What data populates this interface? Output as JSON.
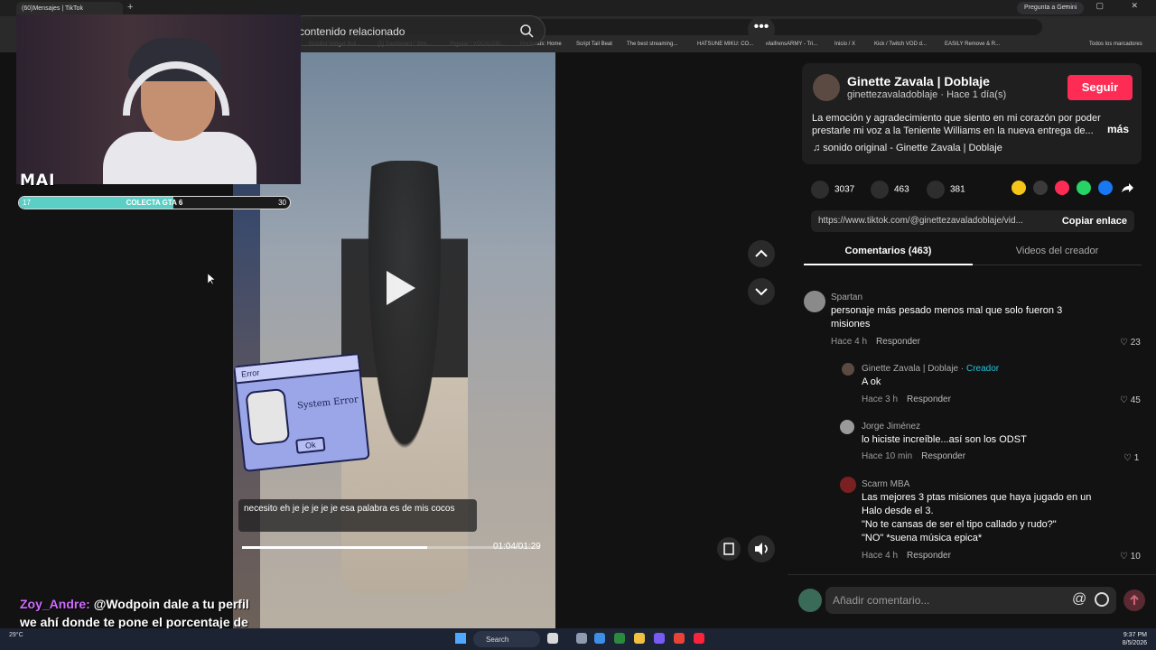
{
  "browser": {
    "tab_title": "(60)Mensajes | TikTok",
    "gemini_label": "Pregunta a Gemini",
    "bookmarks": [
      "KickBot Widget Buil...",
      "(5) Dashboard / Stre...",
      "Popular / VOCALOID...",
      "PreSonus: Home",
      "Script Tail Beat",
      "The best streaming...",
      "HATSUNE MIKU: CO...",
      "MaifrensARMY - Tri...",
      "Inicio / X",
      "Kick / Twitch VOD d...",
      "EASILY Remove & R..."
    ],
    "all_bookmarks": "Todos los marcadores"
  },
  "video": {
    "search_placeholder": "contenido relacionado",
    "caption": "necesito eh je je je je je esa palabra es de mis cocos",
    "time": "01:04/01:29",
    "progress": 0.62
  },
  "sticker": {
    "title": "Error",
    "message": "System Error",
    "ok": "Ok"
  },
  "overlay": {
    "mai_label": "MAI",
    "goal": {
      "start": "17",
      "label": "COLECTA GTA 6",
      "end": "30",
      "progress": 0.57
    }
  },
  "chat": {
    "user": "Zoy_Andre:",
    "message": "@Wodpoin dale a tu perfil we ahí donde te pone el porcentaje de nivel dice"
  },
  "post": {
    "author": "Ginette Zavala | Doblaje",
    "handle": "ginettezavaladoblaje · Hace 1 día(s)",
    "follow": "Seguir",
    "description": "La emoción y agradecimiento que siento en mi corazón por poder prestarle mi voz a la Teniente Williams en la nueva entrega de...",
    "more": "más",
    "sound": "♫ sonido original - Ginette Zavala | Doblaje",
    "likes": "3037",
    "comments": "463",
    "saves": "381",
    "url": "https://www.tiktok.com/@ginettezavaladoblaje/vid...",
    "copy": "Copiar enlace",
    "tab_comments": "Comentarios (463)",
    "tab_videos": "Videos del creador"
  },
  "comments": [
    {
      "user": "Spartan",
      "text": "personaje más pesado menos mal que solo fueron 3 misiones",
      "time": "Hace 4 h",
      "reply": "Responder",
      "likes": "23"
    },
    {
      "user": "Ginette Zavala | Doblaje",
      "creator": "Creador",
      "text": "A ok",
      "time": "Hace 3 h",
      "reply": "Responder",
      "likes": "45"
    },
    {
      "user": "Jorge Jiménez",
      "text": "lo hiciste increíble...así son los ODST",
      "time": "Hace 10 min",
      "reply": "Responder",
      "likes": "1"
    },
    {
      "user": "Scarm MBA",
      "text1": "Las mejores 3 ptas misiones que haya jugado en un",
      "text2": "Halo desde el 3.",
      "text3": "\"No te cansas de ser el tipo callado y rudo?\"",
      "text4": "\"NO\" *suena música epica*",
      "time": "Hace 4 h",
      "reply": "Responder",
      "likes": "10"
    }
  ],
  "composer": {
    "placeholder": "Añadir comentario..."
  },
  "taskbar": {
    "search": "Search",
    "time": "9:37 PM",
    "date": "8/5/2026",
    "weather": "29°C"
  },
  "colors": {
    "accent": "#fe2c55",
    "creator": "#25c3e0",
    "goal": "#5bcfc5"
  }
}
